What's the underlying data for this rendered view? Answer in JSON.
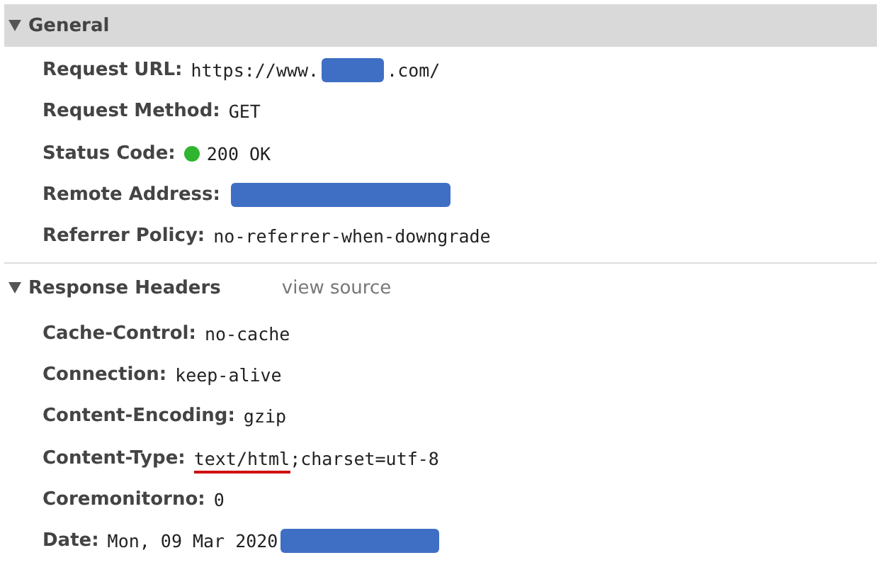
{
  "sections": [
    {
      "title": "General",
      "expanded": true,
      "selected": true,
      "rows": [
        {
          "name": "Request URL:",
          "value": [
            {
              "kind": "text",
              "text": "https://www."
            },
            {
              "kind": "redacted"
            },
            {
              "kind": "text",
              "text": ".com/"
            }
          ]
        },
        {
          "name": "Request Method:",
          "value": [
            {
              "kind": "text",
              "text": "GET"
            }
          ]
        },
        {
          "name": "Status Code:",
          "value": [
            {
              "kind": "status_dot",
              "color": "#2fb52f"
            },
            {
              "kind": "text",
              "text": "200 OK"
            }
          ]
        },
        {
          "name": "Remote Address:",
          "value": [
            {
              "kind": "redacted"
            }
          ]
        },
        {
          "name": "Referrer Policy:",
          "value": [
            {
              "kind": "text",
              "text": "no-referrer-when-downgrade"
            }
          ]
        }
      ]
    },
    {
      "title": "Response Headers",
      "expanded": true,
      "selected": false,
      "link": "view source",
      "rows": [
        {
          "name": "Cache-Control:",
          "value": [
            {
              "kind": "text",
              "text": "no-cache"
            }
          ]
        },
        {
          "name": "Connection:",
          "value": [
            {
              "kind": "text",
              "text": "keep-alive"
            }
          ]
        },
        {
          "name": "Content-Encoding:",
          "value": [
            {
              "kind": "text",
              "text": "gzip"
            }
          ]
        },
        {
          "name": "Content-Type:",
          "value": [
            {
              "kind": "text",
              "text": "text/html",
              "underlined": true
            },
            {
              "kind": "text",
              "text": ";charset=utf-8"
            }
          ]
        },
        {
          "name": "Coremonitorno:",
          "value": [
            {
              "kind": "text",
              "text": "0"
            }
          ]
        },
        {
          "name": "Date:",
          "value": [
            {
              "kind": "text",
              "text": "Mon, 09 Mar 2020"
            },
            {
              "kind": "redacted"
            }
          ]
        }
      ]
    }
  ]
}
